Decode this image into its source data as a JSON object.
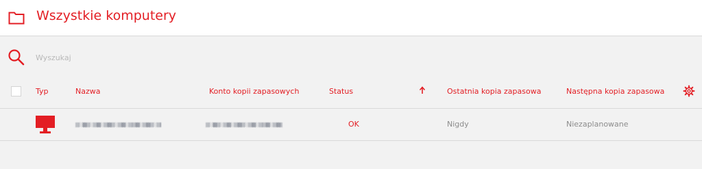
{
  "header": {
    "title": "Wszystkie komputery",
    "icon": "folder-icon"
  },
  "search": {
    "placeholder": "Wyszukaj",
    "icon": "search-icon"
  },
  "table": {
    "columns": [
      "Typ",
      "Nazwa",
      "Konto kopii zapasowych",
      "Status",
      "Ostatnia kopia zapasowa",
      "Następna kopia zapasowa"
    ],
    "sort_icon": "arrow-up-icon",
    "settings_icon": "gear-icon",
    "rows": [
      {
        "type_icon": "monitor-icon",
        "name": "",
        "account": "",
        "status": "OK",
        "last_backup": "Nigdy",
        "next_backup": "Niezaplanowane"
      }
    ]
  },
  "colors": {
    "accent": "#e31e24",
    "background": "#f2f2f2",
    "muted_text": "#8c8c8c"
  }
}
